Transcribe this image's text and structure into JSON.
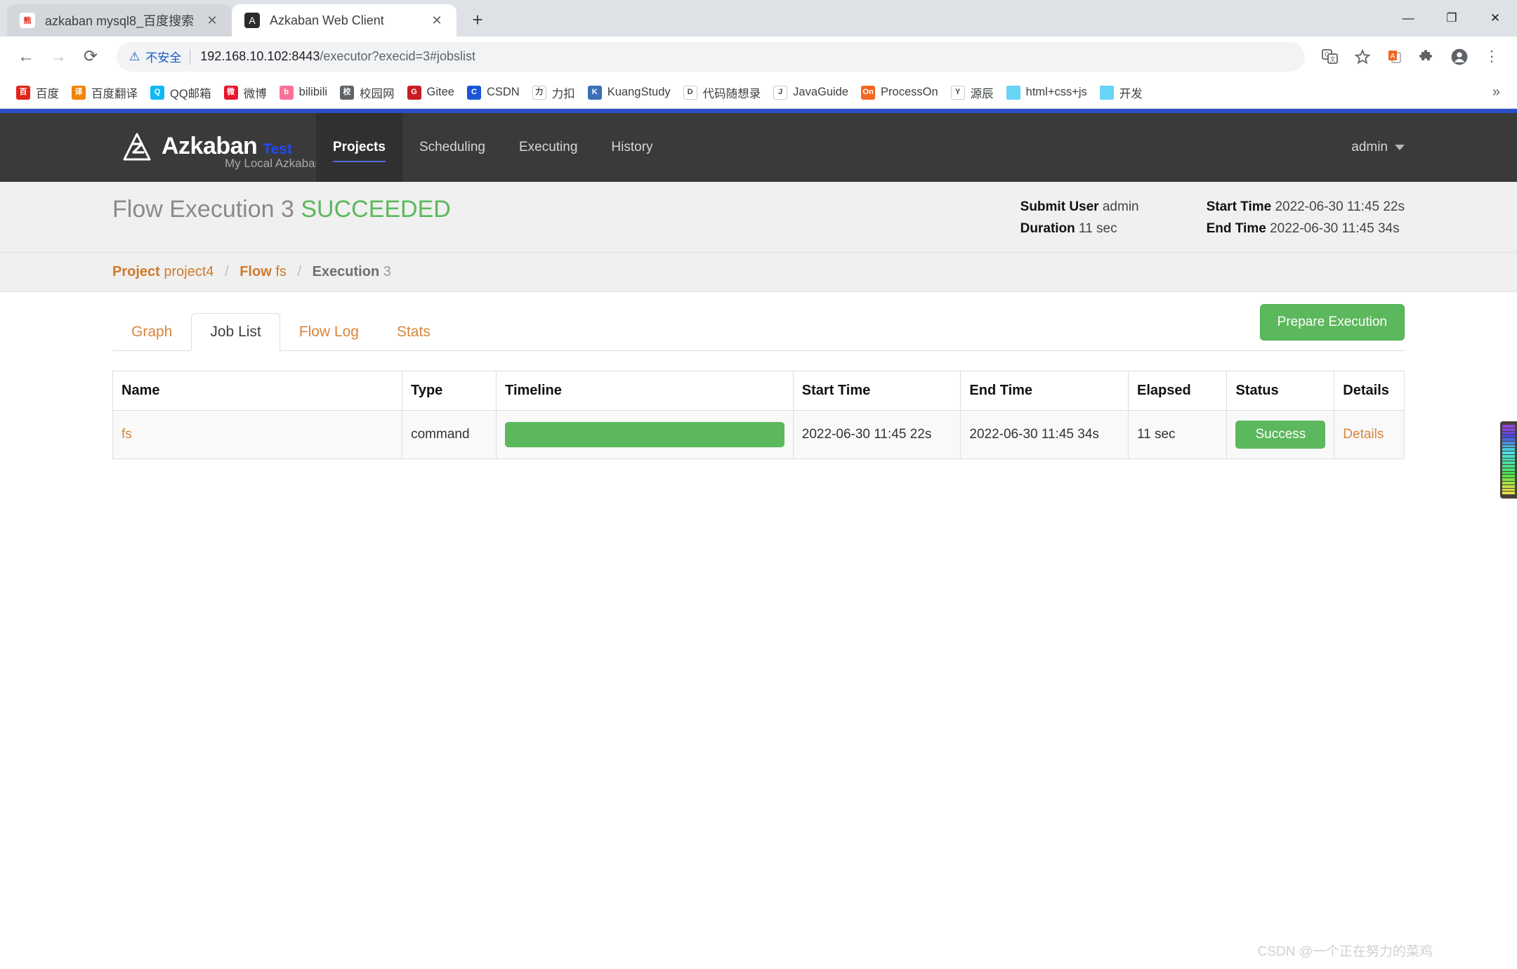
{
  "browser": {
    "tabs": [
      {
        "title": "azkaban mysql8_百度搜索",
        "favicon": "baidu-icon",
        "active": false
      },
      {
        "title": "Azkaban Web Client",
        "favicon": "azkaban-icon",
        "active": true
      }
    ],
    "new_tab_label": "+",
    "close_label": "✕",
    "window_controls": {
      "minimize": "—",
      "maximize": "❐",
      "close": "✕"
    },
    "nav": {
      "back": "←",
      "forward": "→",
      "reload": "⟳"
    },
    "omnibox": {
      "warning_icon": "warning-triangle-icon",
      "warning_text": "不安全",
      "url_host": "192.168.10.102:8443",
      "url_path": "/executor?execid=3#jobslist"
    },
    "toolbar_icons": [
      {
        "name": "translate-icon",
        "glyph": "文"
      },
      {
        "name": "bookmark-star-icon",
        "glyph": "☆"
      },
      {
        "name": "extension-translate-icon",
        "glyph": "A"
      },
      {
        "name": "extensions-puzzle-icon",
        "glyph": "🧩"
      },
      {
        "name": "profile-avatar-icon",
        "glyph": "●"
      },
      {
        "name": "chrome-menu-icon",
        "glyph": "⋮"
      }
    ],
    "bookmarks": [
      {
        "label": "百度",
        "icon": "baidu-icon",
        "color": "#e1251b",
        "letter": "百"
      },
      {
        "label": "百度翻译",
        "icon": "baidu-translate-icon",
        "color": "#f08300",
        "letter": "译"
      },
      {
        "label": "QQ邮箱",
        "icon": "qq-mail-icon",
        "color": "#12b7f5",
        "letter": "Q"
      },
      {
        "label": "微博",
        "icon": "weibo-icon",
        "color": "#e6162d",
        "letter": "微"
      },
      {
        "label": "bilibili",
        "icon": "bilibili-icon",
        "color": "#fb7299",
        "letter": "b"
      },
      {
        "label": "校园网",
        "icon": "campus-net-icon",
        "color": "#5f6368",
        "letter": "校"
      },
      {
        "label": "Gitee",
        "icon": "gitee-icon",
        "color": "#c71d23",
        "letter": "G"
      },
      {
        "label": "CSDN",
        "icon": "csdn-icon",
        "color": "#1a55d6",
        "letter": "C"
      },
      {
        "label": "力扣",
        "icon": "leetcode-icon",
        "color": "#ffffff",
        "letter": "力"
      },
      {
        "label": "KuangStudy",
        "icon": "kuangstudy-icon",
        "color": "#3b6fb6",
        "letter": "K"
      },
      {
        "label": "代码随想录",
        "icon": "daima-icon",
        "color": "#ffffff",
        "letter": "D"
      },
      {
        "label": "JavaGuide",
        "icon": "javaguide-icon",
        "color": "#ffffff",
        "letter": "J"
      },
      {
        "label": "ProcessOn",
        "icon": "processon-icon",
        "color": "#f26722",
        "letter": "On"
      },
      {
        "label": "源辰",
        "icon": "yuanchen-icon",
        "color": "#ffffff",
        "letter": "Y"
      },
      {
        "label": "html+css+js",
        "icon": "folder-icon",
        "color": "#67d3f5",
        "letter": ""
      },
      {
        "label": "开发",
        "icon": "folder-icon",
        "color": "#67d3f5",
        "letter": ""
      }
    ],
    "bookmarks_overflow": "»"
  },
  "azkaban": {
    "brand": {
      "logo_icon": "azkaban-logo-icon",
      "name": "Azkaban",
      "env": "Test",
      "subtitle": "My Local Azkaban"
    },
    "nav_links": [
      {
        "label": "Projects",
        "active": true
      },
      {
        "label": "Scheduling",
        "active": false
      },
      {
        "label": "Executing",
        "active": false
      },
      {
        "label": "History",
        "active": false
      }
    ],
    "user": {
      "label": "admin",
      "caret_icon": "chevron-down-icon"
    },
    "execution": {
      "title_prefix": "Flow Execution 3",
      "status": "SUCCEEDED",
      "meta": [
        {
          "label": "Submit User",
          "value": "admin"
        },
        {
          "label": "Duration",
          "value": "11 sec"
        }
      ],
      "meta2": [
        {
          "label": "Start Time",
          "value": "2022-06-30 11:45 22s"
        },
        {
          "label": "End Time",
          "value": "2022-06-30 11:45 34s"
        }
      ]
    },
    "breadcrumb": {
      "project_label": "Project",
      "project_value": "project4",
      "flow_label": "Flow",
      "flow_value": "fs",
      "execution_label": "Execution",
      "execution_value": "3",
      "separator": "/"
    },
    "tabs": [
      {
        "label": "Graph",
        "active": false
      },
      {
        "label": "Job List",
        "active": true
      },
      {
        "label": "Flow Log",
        "active": false
      },
      {
        "label": "Stats",
        "active": false
      }
    ],
    "prepare_button": "Prepare Execution",
    "table": {
      "headers": [
        "Name",
        "Type",
        "Timeline",
        "Start Time",
        "End Time",
        "Elapsed",
        "Status",
        "Details"
      ],
      "rows": [
        {
          "name": "fs",
          "type": "command",
          "timeline_pct": 100,
          "start_time": "2022-06-30 11:45 22s",
          "end_time": "2022-06-30 11:45 34s",
          "elapsed": "11 sec",
          "status": "Success",
          "details": "Details"
        }
      ]
    }
  },
  "watermark": "CSDN @一个正在努力的菜鸡",
  "colors": {
    "success_green": "#5cb85c",
    "accent_orange": "#d9853b",
    "nav_dark": "#3a3a3a",
    "topbar_blue": "#2b4fc7"
  }
}
